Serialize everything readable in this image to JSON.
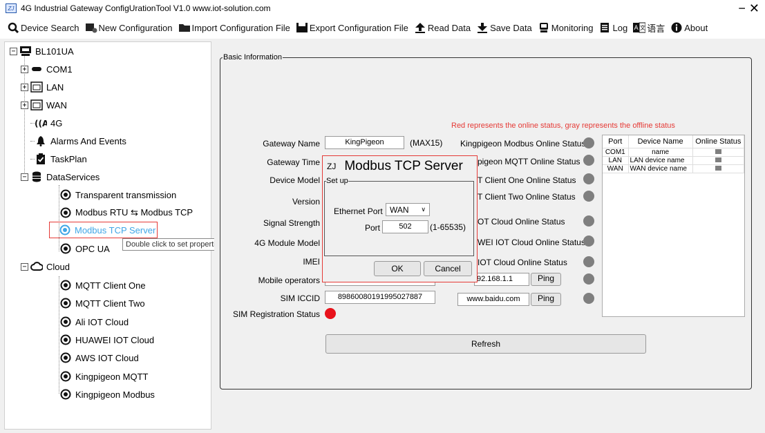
{
  "window": {
    "title": "4G Industrial Gateway ConfigUrationTool V1.0 www.iot-solution.com",
    "close": "− ✕"
  },
  "toolbar": {
    "items": [
      {
        "label": "Device Search",
        "icon": "search-icon"
      },
      {
        "label": "New Configuration",
        "icon": "new-config-icon"
      },
      {
        "label": "Import Configuration File",
        "icon": "folder-icon"
      },
      {
        "label": "Export Configuration File",
        "icon": "save-disk-icon"
      },
      {
        "label": "Read Data",
        "icon": "arrow-up-icon"
      },
      {
        "label": "Save Data",
        "icon": "arrow-down-icon"
      },
      {
        "label": "Monitoring",
        "icon": "monitor-icon"
      },
      {
        "label": "Log",
        "icon": "log-icon"
      },
      {
        "label": "语言",
        "icon": "language-icon"
      },
      {
        "label": "About",
        "icon": "info-icon"
      }
    ]
  },
  "tree": {
    "root": "BL101UA",
    "items": [
      {
        "label": "COM1"
      },
      {
        "label": "LAN"
      },
      {
        "label": "WAN"
      },
      {
        "label": "4G"
      },
      {
        "label": "Alarms And Events"
      },
      {
        "label": "TaskPlan"
      },
      {
        "label": "DataServices"
      },
      {
        "label": "Transparent transmission"
      },
      {
        "label": "Modbus RTU ⇆ Modbus TCP"
      },
      {
        "label": "Modbus TCP Server"
      },
      {
        "label": "OPC UA"
      },
      {
        "label": "Cloud"
      },
      {
        "label": "MQTT Client One"
      },
      {
        "label": "MQTT Client Two"
      },
      {
        "label": "Ali IOT Cloud"
      },
      {
        "label": "HUAWEI IOT Cloud"
      },
      {
        "label": "AWS IOT Cloud"
      },
      {
        "label": "Kingpigeon MQTT"
      },
      {
        "label": "Kingpigeon Modbus"
      }
    ],
    "tooltip": "Double click to set properties"
  },
  "basic": {
    "legend": "Basic Information",
    "legend_note": "Red represents the online status, gray represents the offline status",
    "gateway_name_label": "Gateway Name",
    "gateway_name_value": "KingPigeon",
    "gateway_name_hint": "(MAX15)",
    "gateway_time_label": "Gateway Time",
    "device_model_label": "Device Model",
    "version_label": "Version",
    "signal_strength_label": "Signal Strength",
    "module_model_label": "4G Module Model",
    "imei_label": "IMEI",
    "mobile_operators_label": "Mobile operators",
    "sim_iccid_label": "SIM ICCID",
    "sim_iccid_value": "89860080191995027887",
    "sim_reg_label": "SIM Registration Status",
    "online_labels": [
      "Kingpigeon Modbus Online Status",
      "pigeon MQTT Online Status",
      "T Client One Online Status",
      "T Client Two Online Status",
      "OT Cloud Online Status",
      "WEI IOT Cloud Online Status",
      "IOT Cloud Online Status"
    ],
    "ping1_value": "92.168.1.1",
    "ping2_value": "www.baidu.com",
    "ping_label": "Ping",
    "refresh_label": "Refresh",
    "colors": {
      "online": "#e8121b",
      "offline": "#7f7f7f"
    }
  },
  "ports_table": {
    "headers": [
      "Port",
      "Device Name",
      "Online Status"
    ],
    "rows": [
      {
        "port": "COM1",
        "name": "name"
      },
      {
        "port": "LAN",
        "name": "LAN device name"
      },
      {
        "port": "WAN",
        "name": "WAN device name"
      }
    ]
  },
  "dialog": {
    "title": "Modbus TCP Server",
    "group": "Set up",
    "eth_port_label": "Ethernet Port",
    "eth_port_value": "WAN",
    "port_label": "Port",
    "port_value": "502",
    "port_range": "(1-65535)",
    "ok_label": "OK",
    "cancel_label": "Cancel"
  }
}
